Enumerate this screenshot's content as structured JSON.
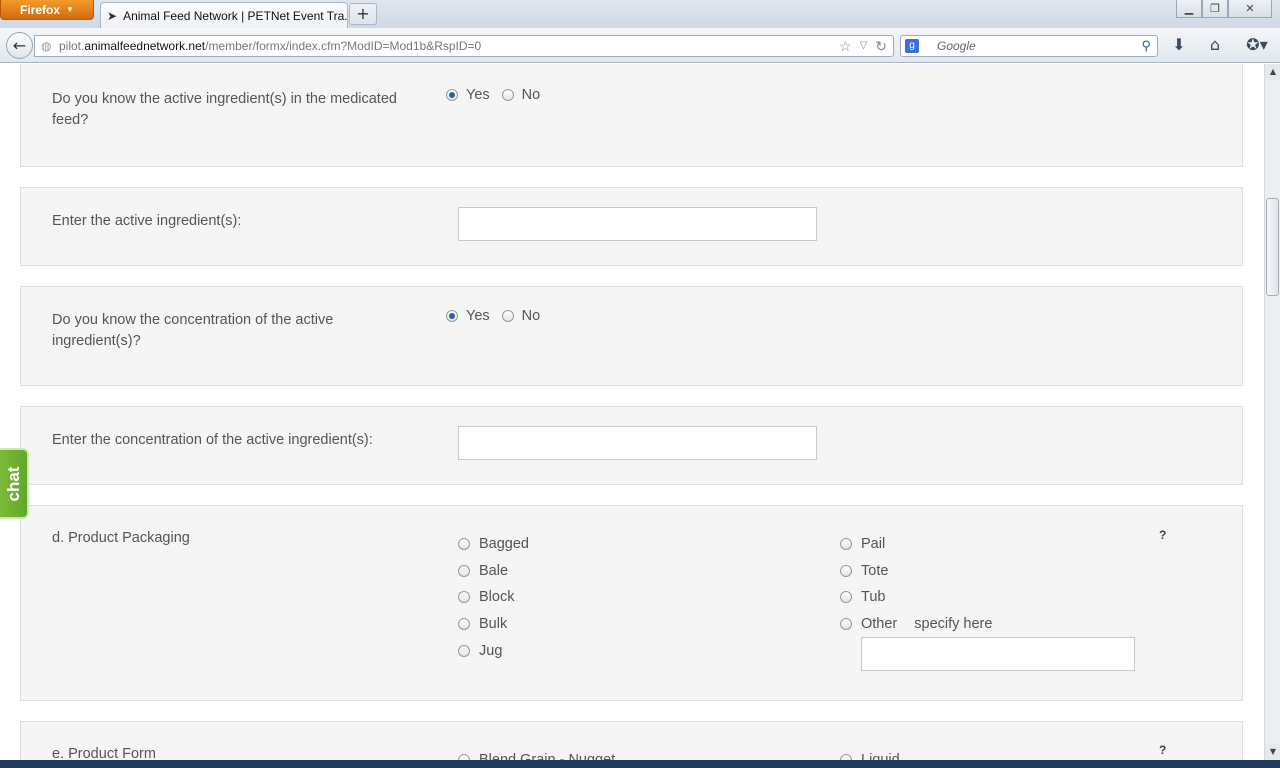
{
  "browser": {
    "app_button": "Firefox",
    "tab_title": "Animal Feed Network | PETNet Event Tra...",
    "url_prefix": "pilot.",
    "url_domain": "animalfeednetwork.net",
    "url_path": "/member/formx/index.cfm?ModID=Mod1b&RspID=0",
    "search_placeholder": "Google"
  },
  "form": {
    "q_know_ingredients": {
      "label": "Do you know the active ingredient(s) in the medicated feed?",
      "options": [
        "Yes",
        "No"
      ],
      "selected": "Yes"
    },
    "q_enter_ingredients": {
      "label": "Enter the active ingredient(s):",
      "value": ""
    },
    "q_know_concentration": {
      "label": "Do you know the concentration of the active ingredient(s)?",
      "options": [
        "Yes",
        "No"
      ],
      "selected": "Yes"
    },
    "q_enter_concentration": {
      "label": "Enter the concentration of the active ingredient(s):",
      "value": ""
    },
    "q_packaging": {
      "label": "d. Product Packaging",
      "help": "?",
      "options_left": [
        "Bagged",
        "Bale",
        "Block",
        "Bulk",
        "Jug"
      ],
      "options_right": [
        "Pail",
        "Tote",
        "Tub",
        "Other"
      ],
      "other_hint": "specify here",
      "other_value": ""
    },
    "q_form": {
      "label": "e. Product Form",
      "help": "?",
      "options_partial": [
        "Blend Grain - Nugget",
        "Liquid"
      ]
    }
  },
  "chat_tab": "chat"
}
